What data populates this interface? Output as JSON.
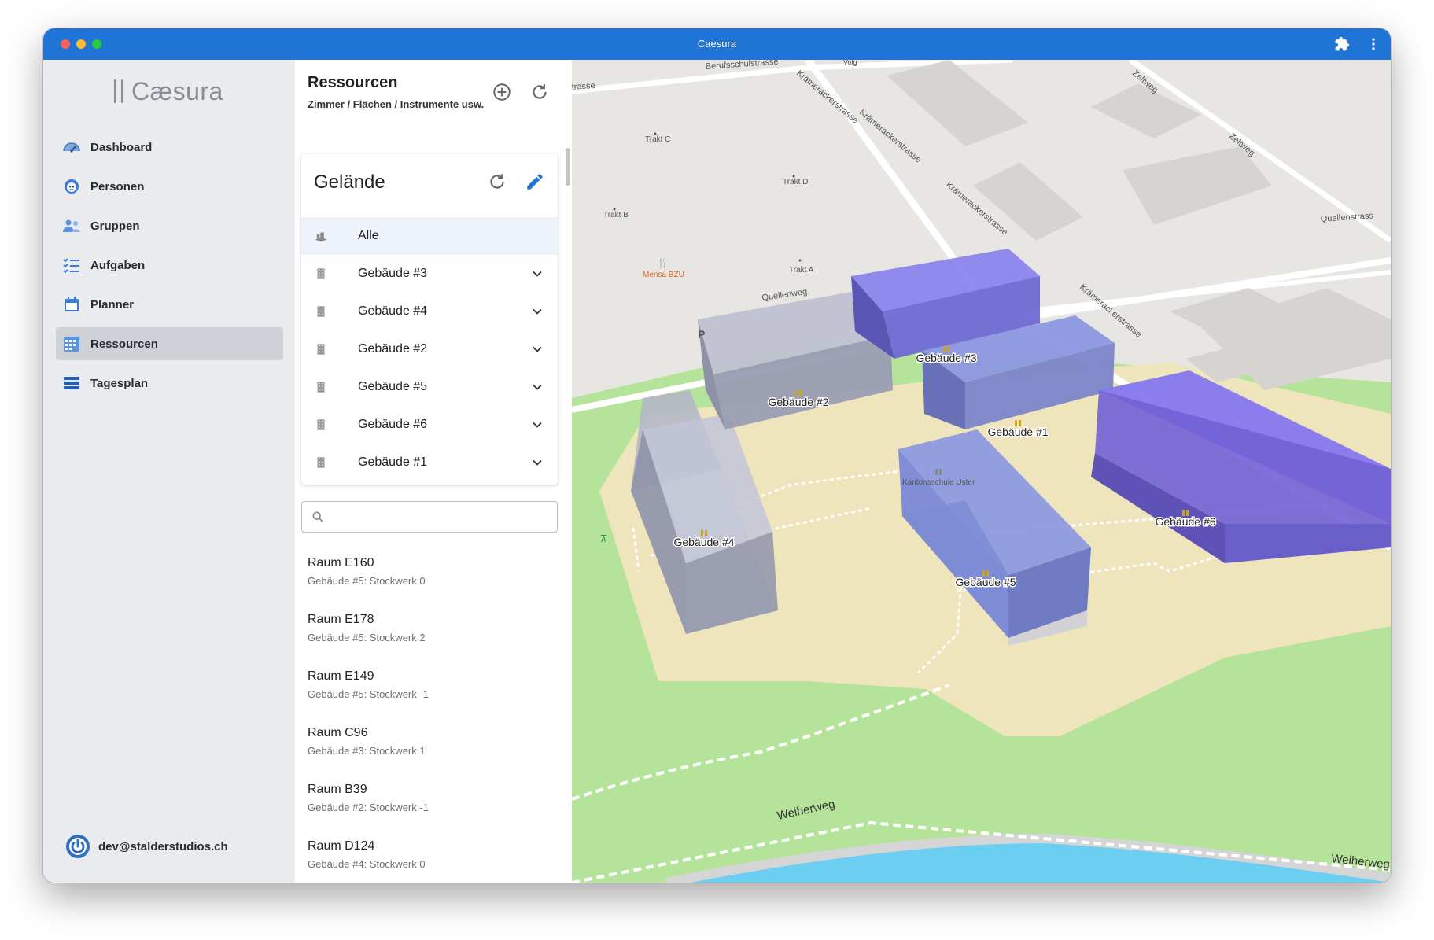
{
  "window": {
    "title": "Caesura"
  },
  "app": {
    "logo_text": "Cæsura"
  },
  "nav": [
    {
      "label": "Dashboard",
      "icon": "dashboard-icon"
    },
    {
      "label": "Personen",
      "icon": "person-icon"
    },
    {
      "label": "Gruppen",
      "icon": "group-icon"
    },
    {
      "label": "Aufgaben",
      "icon": "checklist-icon"
    },
    {
      "label": "Planner",
      "icon": "calendar-icon"
    },
    {
      "label": "Ressourcen",
      "icon": "resources-icon",
      "active": true
    },
    {
      "label": "Tagesplan",
      "icon": "dayplan-icon"
    }
  ],
  "user": {
    "email": "dev@stalderstudios.ch"
  },
  "resources": {
    "title": "Ressourcen",
    "subtitle": "Zimmer / Flächen / Instrumente usw.",
    "site": {
      "title": "Gelände",
      "items": [
        {
          "label": "Alle",
          "icon": "site-icon",
          "selected": true
        },
        {
          "label": "Gebäude #3",
          "icon": "building-icon"
        },
        {
          "label": "Gebäude #4",
          "icon": "building-icon"
        },
        {
          "label": "Gebäude #2",
          "icon": "building-icon"
        },
        {
          "label": "Gebäude #5",
          "icon": "building-icon"
        },
        {
          "label": "Gebäude #6",
          "icon": "building-icon"
        },
        {
          "label": "Gebäude #1",
          "icon": "building-icon"
        }
      ]
    },
    "search": {
      "value": "",
      "placeholder": ""
    },
    "rooms": [
      {
        "name": "Raum E160",
        "location": "Gebäude #5: Stockwerk 0"
      },
      {
        "name": "Raum E178",
        "location": "Gebäude #5: Stockwerk 2"
      },
      {
        "name": "Raum E149",
        "location": "Gebäude #5: Stockwerk -1"
      },
      {
        "name": "Raum C96",
        "location": "Gebäude #3: Stockwerk 1"
      },
      {
        "name": "Raum B39",
        "location": "Gebäude #2: Stockwerk -1"
      },
      {
        "name": "Raum D124",
        "location": "Gebäude #4: Stockwerk 0"
      }
    ]
  },
  "map": {
    "streets": {
      "berufsschulstrasse": "Berufsschulstrasse",
      "kraemerackerstrasse": "Krämerackerstrasse",
      "zeltweg": "Zeltweg",
      "quellenstrasse": "Quellenstrass",
      "quellenweg": "Quellenweg",
      "weiherweg": "Weiherweg",
      "trasse": "trasse",
      "volg": "Volg"
    },
    "pois": {
      "trakt_a": "Trakt A",
      "trakt_b": "Trakt B",
      "trakt_c": "Trakt C",
      "trakt_d": "Trakt D",
      "mensa": "Mensa BZU",
      "kantonsschule": "Kantonsschule Uster",
      "parking": "P"
    },
    "buildings": {
      "b1": "Gebäude #1",
      "b2": "Gebäude #2",
      "b3": "Gebäude #3",
      "b4": "Gebäude #4",
      "b5": "Gebäude #5",
      "b6": "Gebäude #6"
    },
    "colors": {
      "ground": "#e8e6e3",
      "campus": "#efe5bd",
      "grass": "#b6e39a",
      "water": "#6ccff2",
      "building_grey": "#9c9fb4",
      "building_blue": "#7f86e2",
      "building_violet": "#7e6fe0"
    }
  }
}
